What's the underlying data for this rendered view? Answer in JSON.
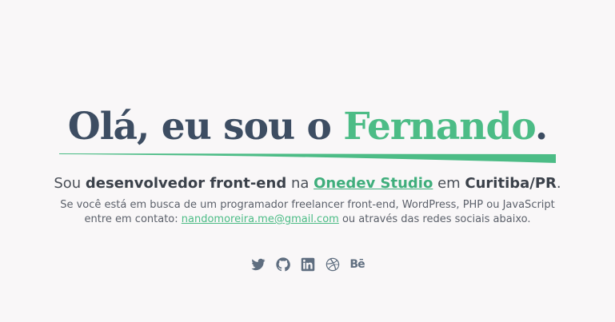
{
  "hero": {
    "greeting": "Olá, eu sou o ",
    "name": "Fernando",
    "period": "."
  },
  "lead": {
    "prefix": "Sou ",
    "role": "desenvolvedor front-end",
    "middle": " na ",
    "company": "Onedev Studio",
    "location_prefix": " em ",
    "location": "Curitiba/PR",
    "suffix": "."
  },
  "sub": {
    "line1": "Se você está em busca de um programador freelancer front-end, WordPress, PHP ou JavaScript",
    "line2_prefix": "entre em contato: ",
    "email": "nandomoreira.me@gmail.com",
    "line2_suffix": " ou através das redes sociais abaixo."
  },
  "social": {
    "items": [
      {
        "name": "twitter",
        "icon": "twitter-icon"
      },
      {
        "name": "github",
        "icon": "github-icon"
      },
      {
        "name": "linkedin",
        "icon": "linkedin-icon"
      },
      {
        "name": "dribbble",
        "icon": "dribbble-icon"
      },
      {
        "name": "behance",
        "icon": "behance-icon",
        "label": "Bē"
      }
    ]
  },
  "colors": {
    "background": "#f9f7f8",
    "heading": "#3d4d62",
    "accent": "#4cbc86",
    "icon": "#5f6e80"
  }
}
